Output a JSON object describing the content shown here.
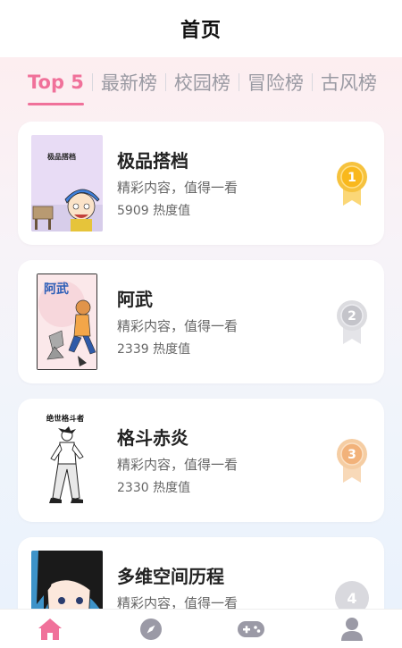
{
  "header": {
    "title": "首页"
  },
  "tabs": [
    {
      "label": "Top 5",
      "active": true
    },
    {
      "label": "最新榜"
    },
    {
      "label": "校园榜"
    },
    {
      "label": "冒险榜"
    },
    {
      "label": "古风榜"
    }
  ],
  "books": [
    {
      "title": "极品搭档",
      "desc": "精彩内容，值得一看",
      "hot": "5909 热度值",
      "rank": "1",
      "cover_text": "极品搭档"
    },
    {
      "title": "阿武",
      "desc": "精彩内容，值得一看",
      "hot": "2339 热度值",
      "rank": "2",
      "cover_text": "阿武"
    },
    {
      "title": "格斗赤炎",
      "desc": "精彩内容，值得一看",
      "hot": "2330 热度值",
      "rank": "3",
      "cover_text": "绝世格斗者"
    },
    {
      "title": "多维空间历程",
      "desc": "精彩内容，值得一看",
      "hot": "",
      "rank": "4"
    }
  ],
  "nav": [
    {
      "icon": "home-icon",
      "active": true
    },
    {
      "icon": "compass-icon"
    },
    {
      "icon": "gamepad-icon"
    },
    {
      "icon": "user-icon"
    }
  ],
  "colors": {
    "accent": "#f0719a",
    "gold": "#f6c23e",
    "silver": "#cfcfd4",
    "bronze": "#f2bf8f",
    "nav_inactive": "#9b9aa6"
  }
}
